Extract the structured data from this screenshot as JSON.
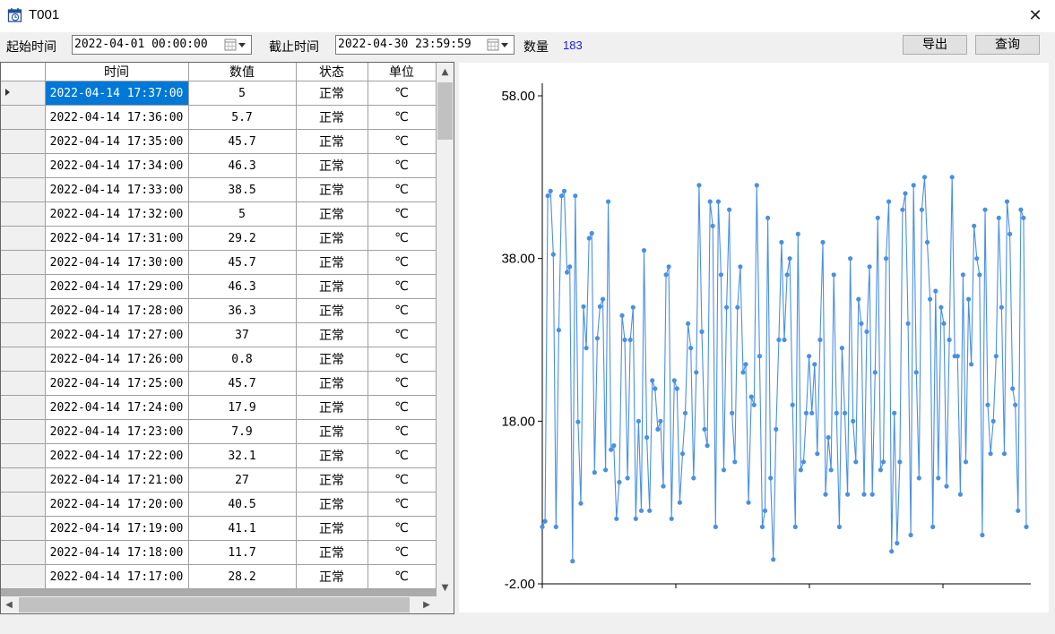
{
  "window": {
    "title": "T001"
  },
  "toolbar": {
    "start_label": "起始时间",
    "start_value": "2022-04-01 00:00:00",
    "end_label": "截止时间",
    "end_value": "2022-04-30 23:59:59",
    "count_label": "数量",
    "count_value": "183",
    "export_label": "导出",
    "query_label": "查询"
  },
  "table": {
    "columns": [
      "时间",
      "数值",
      "状态",
      "单位"
    ],
    "rows": [
      {
        "time": "2022-04-14 17:37:00",
        "value": "5",
        "status": "正常",
        "unit": "℃"
      },
      {
        "time": "2022-04-14 17:36:00",
        "value": "5.7",
        "status": "正常",
        "unit": "℃"
      },
      {
        "time": "2022-04-14 17:35:00",
        "value": "45.7",
        "status": "正常",
        "unit": "℃"
      },
      {
        "time": "2022-04-14 17:34:00",
        "value": "46.3",
        "status": "正常",
        "unit": "℃"
      },
      {
        "time": "2022-04-14 17:33:00",
        "value": "38.5",
        "status": "正常",
        "unit": "℃"
      },
      {
        "time": "2022-04-14 17:32:00",
        "value": "5",
        "status": "正常",
        "unit": "℃"
      },
      {
        "time": "2022-04-14 17:31:00",
        "value": "29.2",
        "status": "正常",
        "unit": "℃"
      },
      {
        "time": "2022-04-14 17:30:00",
        "value": "45.7",
        "status": "正常",
        "unit": "℃"
      },
      {
        "time": "2022-04-14 17:29:00",
        "value": "46.3",
        "status": "正常",
        "unit": "℃"
      },
      {
        "time": "2022-04-14 17:28:00",
        "value": "36.3",
        "status": "正常",
        "unit": "℃"
      },
      {
        "time": "2022-04-14 17:27:00",
        "value": "37",
        "status": "正常",
        "unit": "℃"
      },
      {
        "time": "2022-04-14 17:26:00",
        "value": "0.8",
        "status": "正常",
        "unit": "℃"
      },
      {
        "time": "2022-04-14 17:25:00",
        "value": "45.7",
        "status": "正常",
        "unit": "℃"
      },
      {
        "time": "2022-04-14 17:24:00",
        "value": "17.9",
        "status": "正常",
        "unit": "℃"
      },
      {
        "time": "2022-04-14 17:23:00",
        "value": "7.9",
        "status": "正常",
        "unit": "℃"
      },
      {
        "time": "2022-04-14 17:22:00",
        "value": "32.1",
        "status": "正常",
        "unit": "℃"
      },
      {
        "time": "2022-04-14 17:21:00",
        "value": "27",
        "status": "正常",
        "unit": "℃"
      },
      {
        "time": "2022-04-14 17:20:00",
        "value": "40.5",
        "status": "正常",
        "unit": "℃"
      },
      {
        "time": "2022-04-14 17:19:00",
        "value": "41.1",
        "status": "正常",
        "unit": "℃"
      },
      {
        "time": "2022-04-14 17:18:00",
        "value": "11.7",
        "status": "正常",
        "unit": "℃"
      },
      {
        "time": "2022-04-14 17:17:00",
        "value": "28.2",
        "status": "正常",
        "unit": "℃"
      }
    ]
  },
  "chart_data": {
    "type": "line",
    "title": "",
    "xlabel": "",
    "ylabel": "",
    "ylim": [
      -2,
      58
    ],
    "yticks": [
      "58.00",
      "38.00",
      "18.00",
      "-2.00"
    ],
    "ytick_values": [
      58,
      38,
      18,
      -2
    ],
    "grid": false,
    "series_color": "#4a90e2",
    "series": [
      {
        "values": [
          5,
          5.7,
          45.7,
          46.3,
          38.5,
          5,
          29.2,
          45.7,
          46.3,
          36.3,
          37,
          0.8,
          45.7,
          17.9,
          7.9,
          32.1,
          27,
          40.5,
          41.1,
          11.7,
          28.2,
          32.1,
          33,
          12,
          45,
          14.5,
          15,
          6,
          10.5,
          31,
          28,
          11,
          28,
          32,
          6,
          18,
          7,
          39,
          16,
          7,
          23,
          22,
          17,
          18,
          10,
          36,
          37,
          6,
          23,
          22,
          8,
          14,
          19,
          30,
          27,
          11,
          24,
          47,
          29,
          17,
          15,
          45,
          42,
          5,
          45,
          36,
          12,
          32,
          44,
          19,
          13,
          32,
          37,
          24,
          25,
          8,
          21,
          20,
          47,
          26,
          5,
          7,
          43,
          11,
          1,
          17,
          28,
          40,
          28,
          36,
          38,
          20,
          5,
          41,
          12,
          13,
          19,
          26,
          19,
          25,
          14,
          28,
          40,
          9,
          16,
          12,
          36,
          19,
          5,
          27,
          19,
          9,
          38,
          18,
          13,
          33,
          30,
          9,
          29,
          37,
          9,
          24,
          43,
          12,
          13,
          38,
          45,
          2,
          19,
          3,
          13,
          44,
          46,
          30,
          4,
          47,
          24,
          11,
          44,
          48,
          40,
          33,
          5,
          34,
          11,
          32,
          30,
          10,
          28,
          48,
          26,
          26,
          9,
          36,
          13,
          33,
          25,
          42,
          38,
          36,
          4,
          44,
          20,
          14,
          18,
          26,
          43,
          32,
          14,
          45,
          41,
          22,
          20,
          7,
          44,
          43,
          5
        ]
      }
    ]
  }
}
